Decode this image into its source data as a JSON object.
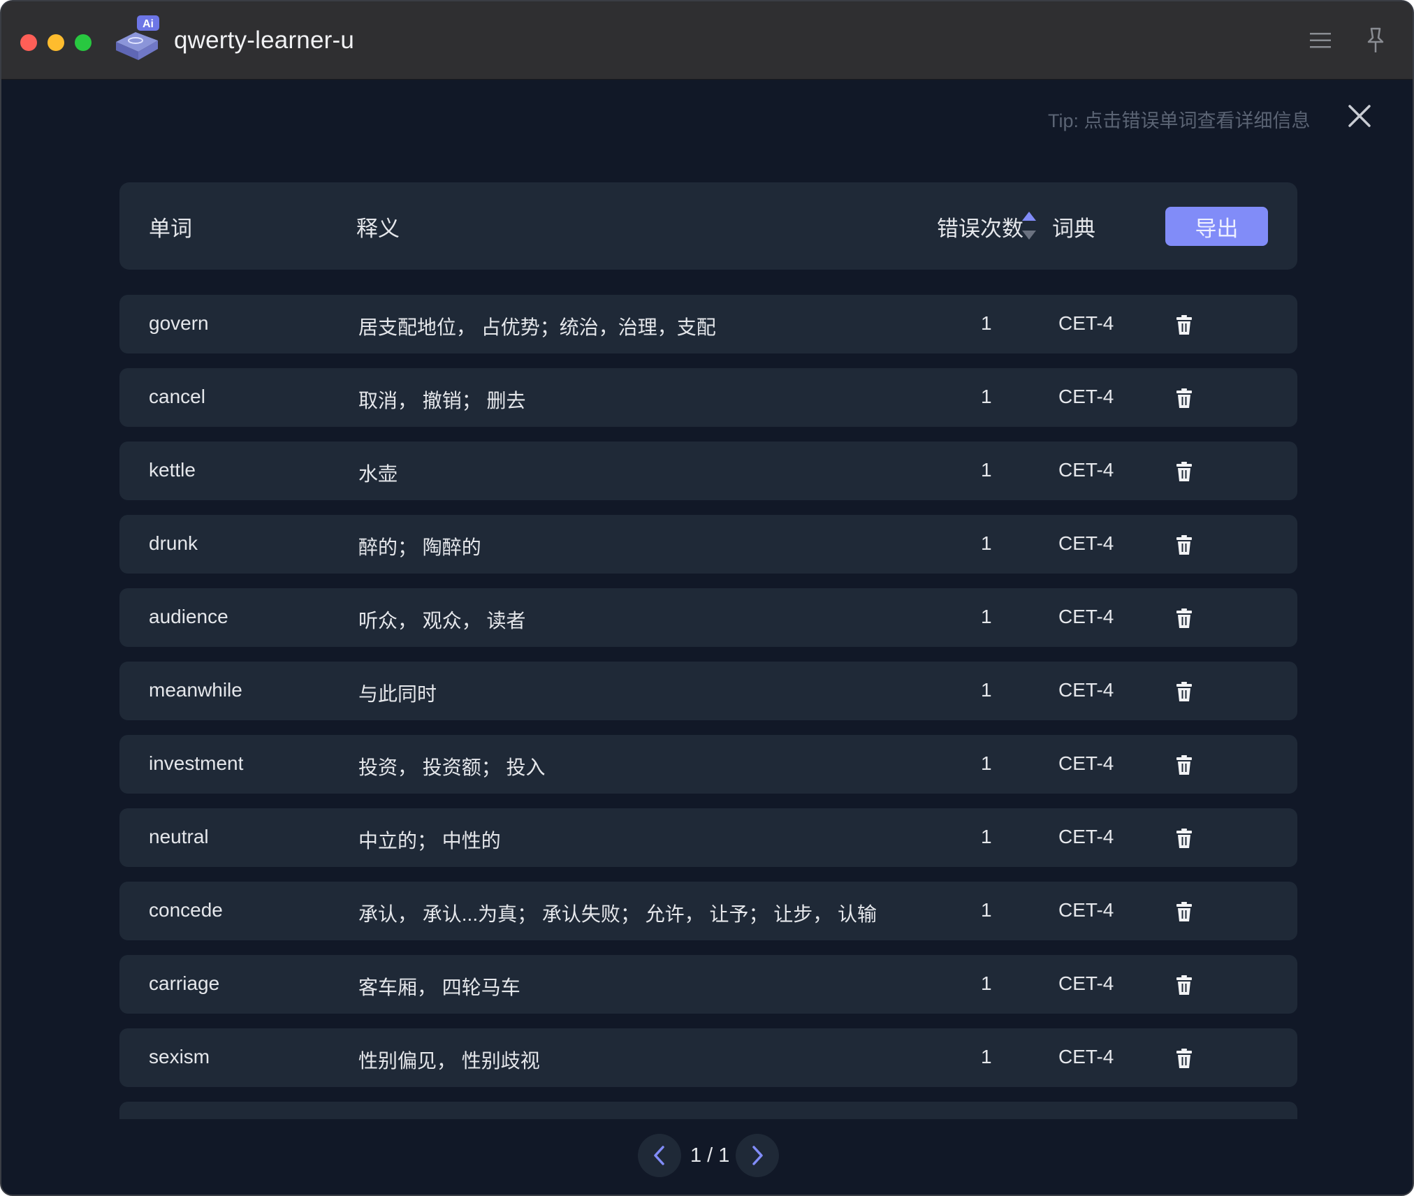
{
  "window": {
    "title": "qwerty-learner-u",
    "logo_badge": "Ai"
  },
  "tip": "Tip: 点击错误单词查看详细信息",
  "table": {
    "headers": {
      "word": "单词",
      "translation": "释义",
      "error_count": "错误次数",
      "dictionary": "词典"
    },
    "export_label": "导出",
    "rows": [
      {
        "word": "govern",
        "translation": "居支配地位， 占优势；统治，治理，支配",
        "count": "1",
        "dict": "CET-4"
      },
      {
        "word": "cancel",
        "translation": "取消， 撤销； 删去",
        "count": "1",
        "dict": "CET-4"
      },
      {
        "word": "kettle",
        "translation": "水壶",
        "count": "1",
        "dict": "CET-4"
      },
      {
        "word": "drunk",
        "translation": "醉的； 陶醉的",
        "count": "1",
        "dict": "CET-4"
      },
      {
        "word": "audience",
        "translation": "听众， 观众， 读者",
        "count": "1",
        "dict": "CET-4"
      },
      {
        "word": "meanwhile",
        "translation": "与此同时",
        "count": "1",
        "dict": "CET-4"
      },
      {
        "word": "investment",
        "translation": "投资， 投资额； 投入",
        "count": "1",
        "dict": "CET-4"
      },
      {
        "word": "neutral",
        "translation": "中立的； 中性的",
        "count": "1",
        "dict": "CET-4"
      },
      {
        "word": "concede",
        "translation": "承认， 承认...为真； 承认失败； 允许， 让予； 让步， 认输",
        "count": "1",
        "dict": "CET-4"
      },
      {
        "word": "carriage",
        "translation": "客车厢， 四轮马车",
        "count": "1",
        "dict": "CET-4"
      },
      {
        "word": "sexism",
        "translation": "性别偏见， 性别歧视",
        "count": "1",
        "dict": "CET-4"
      }
    ]
  },
  "pagination": {
    "text": "1 / 1"
  },
  "colors": {
    "accent": "#818cf8",
    "background": "#111827",
    "row": "#1f2937"
  }
}
